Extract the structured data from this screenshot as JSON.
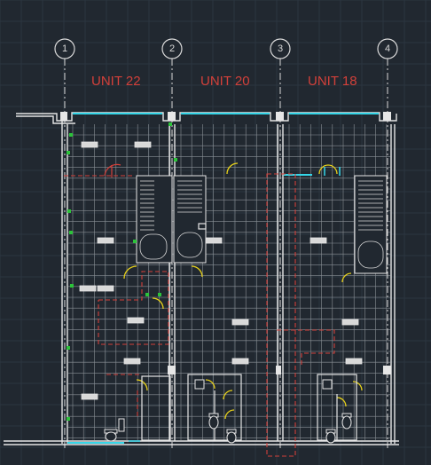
{
  "drawing": {
    "grid_markers": [
      "1",
      "2",
      "3",
      "4"
    ],
    "units": [
      {
        "name": "UNIT 22"
      },
      {
        "name": "UNIT 20"
      },
      {
        "name": "UNIT 18"
      }
    ]
  },
  "colors": {
    "background": "#212830",
    "line": "#e6e6e6",
    "grid": "#8a9096",
    "label": "#d3403a",
    "glass": "#34d6e8",
    "door": "#e8d21a",
    "plant": "#2cc33a",
    "red_dashed": "#d3403a"
  }
}
